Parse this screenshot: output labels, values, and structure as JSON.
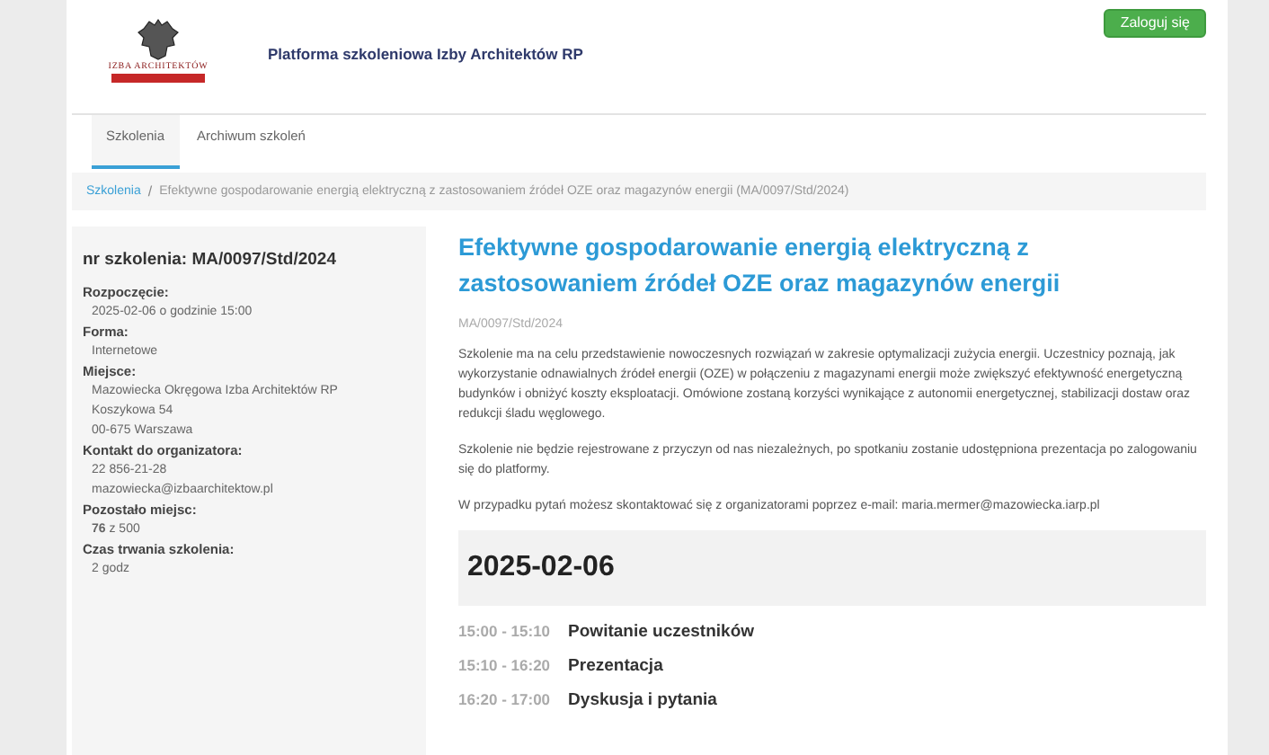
{
  "header": {
    "logo_text": "IZBA ARCHITEKTÓW",
    "title": "Platforma szkoleniowa Izby Architektów RP",
    "login_button": "Zaloguj się"
  },
  "tabs": [
    {
      "label": "Szkolenia",
      "selected": true
    },
    {
      "label": "Archiwum szkoleń",
      "selected": false
    }
  ],
  "breadcrumb_separator": "/",
  "breadcrumb": [
    {
      "label": "Szkolenia",
      "kind": "link"
    },
    {
      "label": "Efektywne gospodarowanie energią elektryczną z zastosowaniem źródeł OZE oraz magazynów energii (MA/0097/Std/2024)",
      "kind": "current"
    }
  ],
  "details": {
    "title": "nr szkolenia: MA/0097/Std/2024",
    "fields": [
      {
        "label": "Rozpoczęcie:",
        "values": [
          "2025-02-06 o godzinie 15:00"
        ]
      },
      {
        "label": "Forma:",
        "values": [
          "Internetowe"
        ]
      },
      {
        "label": "Miejsce:",
        "values": [
          "Mazowiecka Okręgowa Izba Architektów RP",
          "Koszykowa 54",
          "00-675 Warszawa"
        ]
      },
      {
        "label": "Kontakt do organizatora:",
        "values": [
          "22 856-21-28",
          "mazowiecka@izbaarchitektow.pl"
        ]
      },
      {
        "label": "Pozostało miejsc:",
        "values": [
          "**76** z 500"
        ]
      },
      {
        "label": "Czas trwania szkolenia:",
        "values": [
          "2 godz"
        ]
      }
    ]
  },
  "main": {
    "title": "Efektywne gospodarowanie energią elektryczną z zastosowaniem źródeł OZE oraz magazynów energii",
    "code": "MA/0097/Std/2024",
    "paragraphs": [
      "Szkolenie ma na celu przedstawienie nowoczesnych rozwiązań w zakresie optymalizacji zużycia energii. Uczestnicy poznają, jak wykorzystanie odnawialnych źródeł energii (OZE) w połączeniu z magazynami energii może zwiększyć efektywność energetyczną budynków i obniżyć koszty eksploatacji. Omówione zostaną korzyści wynikające z autonomii energetycznej, stabilizacji dostaw oraz redukcji śladu węglowego.",
      "Szkolenie nie będzie rejestrowane z przyczyn od nas niezależnych, po spotkaniu zostanie udostępniona prezentacja po zalogowaniu się do platformy.",
      "W przypadku pytań możesz skontaktować się z organizatorami poprzez e-mail: maria.mermer@mazowiecka.iarp.pl"
    ],
    "date": "2025-02-06",
    "schedule": [
      {
        "time": "15:00 - 15:10",
        "title": "Powitanie uczestników"
      },
      {
        "time": "15:10 - 16:20",
        "title": "Prezentacja"
      },
      {
        "time": "16:20 - 17:00",
        "title": "Dyskusja i pytania"
      }
    ]
  }
}
